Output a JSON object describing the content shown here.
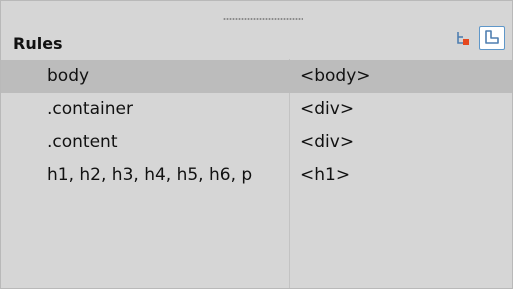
{
  "panel": {
    "title": "Rules",
    "colors": {
      "background": "#d6d6d6",
      "selected_row": "#bcbcbc",
      "divider": "#c3c3c3",
      "accent_blue": "#5f97c9",
      "accent_orange": "#e5481f"
    },
    "toolbar": {
      "cascade_icon": "cascade-rules-icon",
      "current_icon": "current-rules-icon"
    },
    "rows": [
      {
        "rule": "body",
        "tag": "<body>",
        "selected": true
      },
      {
        "rule": ".container",
        "tag": "<div>",
        "selected": false
      },
      {
        "rule": ".content",
        "tag": "<div>",
        "selected": false
      },
      {
        "rule": "h1, h2, h3, h4, h5, h6, p",
        "tag": "<h1>",
        "selected": false
      }
    ]
  }
}
